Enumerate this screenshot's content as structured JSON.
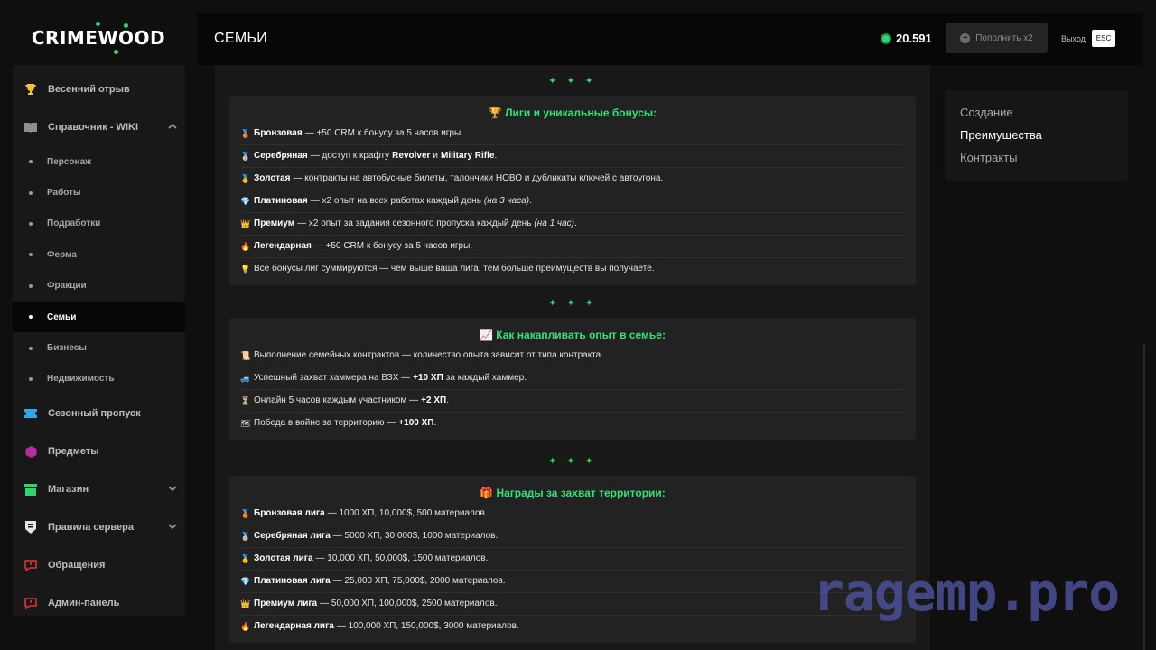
{
  "logo": {
    "text": "CRIMEWOOD"
  },
  "sidebar": {
    "items": [
      {
        "label": "Весенний отрыв",
        "icon": "trophy-icon"
      },
      {
        "label": "Справочник - WIKI",
        "icon": "book-icon"
      },
      {
        "label": "Сезонный пропуск",
        "icon": "ticket-icon"
      },
      {
        "label": "Предметы",
        "icon": "box-icon"
      },
      {
        "label": "Магазин",
        "icon": "shop-icon"
      },
      {
        "label": "Правила сервера",
        "icon": "shield-icon"
      },
      {
        "label": "Обращения",
        "icon": "chat-icon"
      },
      {
        "label": "Админ-панель",
        "icon": "admin-chat-icon"
      }
    ],
    "wiki_sub": [
      "Персонаж",
      "Работы",
      "Подработки",
      "Ферма",
      "Фракции",
      "Семьи",
      "Бизнесы",
      "Недвижимость"
    ],
    "active_sub": "Семьи"
  },
  "header": {
    "title": "СЕМЬИ",
    "balance": "20.591",
    "topup_label": "Пополнить x2",
    "exit_label": "Выход",
    "esc_label": "ESC"
  },
  "separator": "✦ ✦ ✦",
  "sections": [
    {
      "title": "🏆 Лиги и уникальные бонусы:",
      "rows": [
        {
          "icon": "🥉",
          "bold": "Бронзовая",
          "text": "— +50 CRM к бонусу за 5 часов игры."
        },
        {
          "icon": "🥈",
          "bold": "Серебряная",
          "text": "— доступ к крафту",
          "bold2": "Revolver",
          "text2": "и",
          "bold3": "Military Rifle",
          "text3": "."
        },
        {
          "icon": "🥇",
          "bold": "Золотая",
          "text": "— контракты на автобусные билеты, талончики НОВО и дубликаты ключей с автоугона."
        },
        {
          "icon": "💎",
          "bold": "Платиновая",
          "text": "— x2 опыт на всех работах каждый день",
          "italic": "(на 3 часа)",
          "tail": "."
        },
        {
          "icon": "👑",
          "bold": "Премиум",
          "text": "— x2 опыт за задания сезонного пропуска каждый день",
          "italic": "(на 1 час)",
          "tail": "."
        },
        {
          "icon": "🔥",
          "bold": "Легендарная",
          "text": "— +50 CRM к бонусу за 5 часов игры."
        },
        {
          "icon": "💡",
          "bold": "",
          "text": "Все бонусы лиг суммируются — чем выше ваша лига, тем больше преимуществ вы получаете."
        }
      ]
    },
    {
      "title": "📈 Как накапливать опыт в семье:",
      "rows": [
        {
          "icon": "📜",
          "bold": "",
          "text": "Выполнение семейных контрактов — количество опыта зависит от типа контракта."
        },
        {
          "icon": "🚙",
          "bold": "",
          "text": "Успешный захват хаммера на ВЗХ —",
          "bold2": "+10 ХП",
          "text2": "за каждый хаммер."
        },
        {
          "icon": "⏳",
          "bold": "",
          "text": "Онлайн 5 часов каждым участником —",
          "bold2": "+2 ХП",
          "text2": "."
        },
        {
          "icon": "🗺",
          "bold": "",
          "text": "Победа в войне за территорию —",
          "bold2": "+100 ХП",
          "text2": "."
        }
      ]
    },
    {
      "title": "🎁 Награды за захват территории:",
      "rows": [
        {
          "icon": "🥉",
          "bold": "Бронзовая лига",
          "text": "— 1000 ХП, 10,000$, 500 материалов."
        },
        {
          "icon": "🥈",
          "bold": "Серебряная лига",
          "text": "— 5000 ХП, 30,000$, 1000 материалов."
        },
        {
          "icon": "🥇",
          "bold": "Золотая лига",
          "text": "— 10,000 ХП, 50,000$, 1500 материалов."
        },
        {
          "icon": "💎",
          "bold": "Платиновая лига",
          "text": "— 25,000 ХП, 75,000$, 2000 материалов."
        },
        {
          "icon": "👑",
          "bold": "Премиум лига",
          "text": "— 50,000 ХП, 100,000$, 2500 материалов."
        },
        {
          "icon": "🔥",
          "bold": "Легендарная лига",
          "text": "— 100,000 ХП, 150,000$, 3000 материалов."
        }
      ]
    }
  ],
  "toc": {
    "items": [
      "Создание",
      "Преимущества",
      "Контракты"
    ],
    "active": "Преимущества"
  },
  "watermark": "ragemp.pro"
}
